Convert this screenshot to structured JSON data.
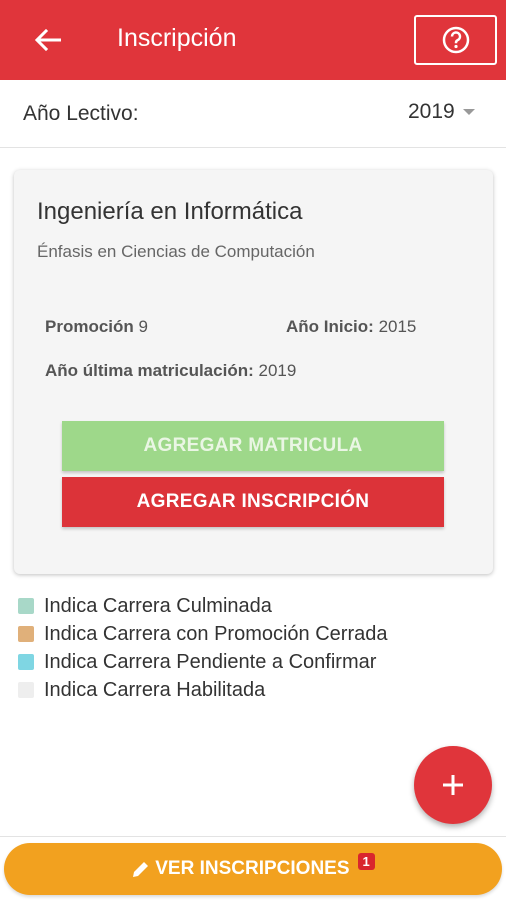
{
  "header": {
    "title": "Inscripción",
    "back_icon": "arrow-left-icon",
    "help_icon": "question-circle-icon"
  },
  "year": {
    "label": "Año Lectivo:",
    "value": "2019"
  },
  "card": {
    "career": "Ingeniería en Informática",
    "emphasis": "Énfasis en Ciencias de Computación",
    "promotion_label": "Promoción",
    "promotion_value": "9",
    "start_label": "Año Inicio:",
    "start_value": "2015",
    "last_label": "Año última matriculación:",
    "last_value": "2019",
    "add_enrollment_label": "AGREGAR MATRICULA",
    "add_inscription_label": "AGREGAR INSCRIPCIÓN"
  },
  "legend": [
    {
      "label": "Indica Carrera Culminada",
      "color": "#a8d8c8"
    },
    {
      "label": "Indica Carrera con Promoción Cerrada",
      "color": "#e0b07a"
    },
    {
      "label": "Indica Carrera Pendiente a Confirmar",
      "color": "#7fd6e3"
    },
    {
      "label": "Indica Carrera Habilitada",
      "color": "#eeeeee"
    }
  ],
  "fab": {
    "icon": "plus-icon"
  },
  "bottom": {
    "label": "VER INSCRIPCIONES",
    "badge": "1",
    "icon": "pencil-icon"
  },
  "colors": {
    "primary": "#e0353b",
    "accent_green": "#9ed88a",
    "accent_orange": "#f2a11f"
  }
}
